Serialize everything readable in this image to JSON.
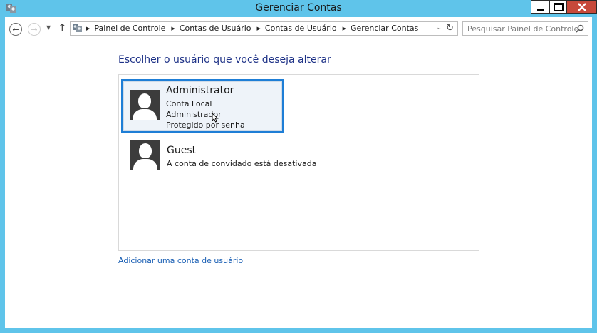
{
  "window": {
    "title": "Gerenciar Contas",
    "icon": "user-accounts-icon"
  },
  "nav": {
    "breadcrumbs": [
      "Painel de Controle",
      "Contas de Usuário",
      "Contas de Usuário",
      "Gerenciar Contas"
    ],
    "search_placeholder": "Pesquisar Painel de Controle"
  },
  "content": {
    "heading": "Escolher o usuário que você deseja alterar",
    "accounts": [
      {
        "name": "Administrator",
        "lines": [
          "Conta Local",
          "Administrador",
          "Protegido por senha"
        ],
        "selected": true
      },
      {
        "name": "Guest",
        "lines": [
          "A conta de convidado está desativada"
        ],
        "selected": false
      }
    ],
    "add_link": "Adicionar uma conta de usuário"
  },
  "colors": {
    "title_bar": "#5fc4ea",
    "close_button": "#c7493a",
    "selection_border": "#1e7ed6",
    "heading_text": "#1e3287",
    "link_text": "#1a5fb4"
  }
}
